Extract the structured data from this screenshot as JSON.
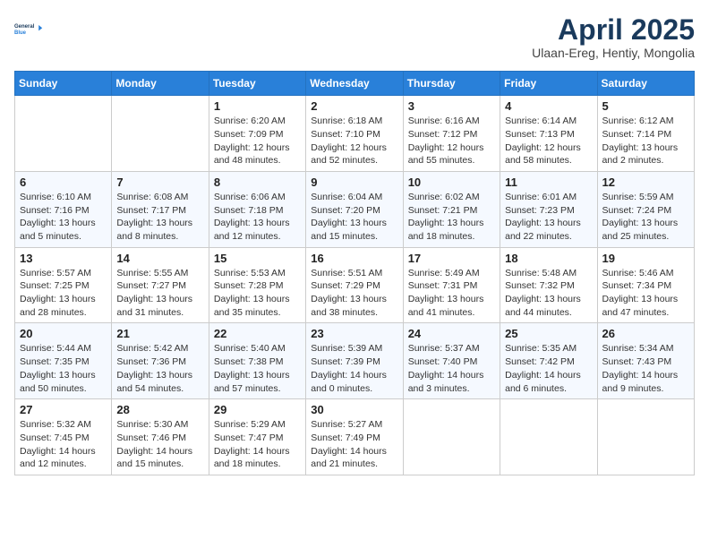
{
  "header": {
    "logo_line1": "General",
    "logo_line2": "Blue",
    "month_title": "April 2025",
    "subtitle": "Ulaan-Ereg, Hentiy, Mongolia"
  },
  "days_of_week": [
    "Sunday",
    "Monday",
    "Tuesday",
    "Wednesday",
    "Thursday",
    "Friday",
    "Saturday"
  ],
  "weeks": [
    [
      {
        "num": "",
        "info": ""
      },
      {
        "num": "",
        "info": ""
      },
      {
        "num": "1",
        "info": "Sunrise: 6:20 AM\nSunset: 7:09 PM\nDaylight: 12 hours and 48 minutes."
      },
      {
        "num": "2",
        "info": "Sunrise: 6:18 AM\nSunset: 7:10 PM\nDaylight: 12 hours and 52 minutes."
      },
      {
        "num": "3",
        "info": "Sunrise: 6:16 AM\nSunset: 7:12 PM\nDaylight: 12 hours and 55 minutes."
      },
      {
        "num": "4",
        "info": "Sunrise: 6:14 AM\nSunset: 7:13 PM\nDaylight: 12 hours and 58 minutes."
      },
      {
        "num": "5",
        "info": "Sunrise: 6:12 AM\nSunset: 7:14 PM\nDaylight: 13 hours and 2 minutes."
      }
    ],
    [
      {
        "num": "6",
        "info": "Sunrise: 6:10 AM\nSunset: 7:16 PM\nDaylight: 13 hours and 5 minutes."
      },
      {
        "num": "7",
        "info": "Sunrise: 6:08 AM\nSunset: 7:17 PM\nDaylight: 13 hours and 8 minutes."
      },
      {
        "num": "8",
        "info": "Sunrise: 6:06 AM\nSunset: 7:18 PM\nDaylight: 13 hours and 12 minutes."
      },
      {
        "num": "9",
        "info": "Sunrise: 6:04 AM\nSunset: 7:20 PM\nDaylight: 13 hours and 15 minutes."
      },
      {
        "num": "10",
        "info": "Sunrise: 6:02 AM\nSunset: 7:21 PM\nDaylight: 13 hours and 18 minutes."
      },
      {
        "num": "11",
        "info": "Sunrise: 6:01 AM\nSunset: 7:23 PM\nDaylight: 13 hours and 22 minutes."
      },
      {
        "num": "12",
        "info": "Sunrise: 5:59 AM\nSunset: 7:24 PM\nDaylight: 13 hours and 25 minutes."
      }
    ],
    [
      {
        "num": "13",
        "info": "Sunrise: 5:57 AM\nSunset: 7:25 PM\nDaylight: 13 hours and 28 minutes."
      },
      {
        "num": "14",
        "info": "Sunrise: 5:55 AM\nSunset: 7:27 PM\nDaylight: 13 hours and 31 minutes."
      },
      {
        "num": "15",
        "info": "Sunrise: 5:53 AM\nSunset: 7:28 PM\nDaylight: 13 hours and 35 minutes."
      },
      {
        "num": "16",
        "info": "Sunrise: 5:51 AM\nSunset: 7:29 PM\nDaylight: 13 hours and 38 minutes."
      },
      {
        "num": "17",
        "info": "Sunrise: 5:49 AM\nSunset: 7:31 PM\nDaylight: 13 hours and 41 minutes."
      },
      {
        "num": "18",
        "info": "Sunrise: 5:48 AM\nSunset: 7:32 PM\nDaylight: 13 hours and 44 minutes."
      },
      {
        "num": "19",
        "info": "Sunrise: 5:46 AM\nSunset: 7:34 PM\nDaylight: 13 hours and 47 minutes."
      }
    ],
    [
      {
        "num": "20",
        "info": "Sunrise: 5:44 AM\nSunset: 7:35 PM\nDaylight: 13 hours and 50 minutes."
      },
      {
        "num": "21",
        "info": "Sunrise: 5:42 AM\nSunset: 7:36 PM\nDaylight: 13 hours and 54 minutes."
      },
      {
        "num": "22",
        "info": "Sunrise: 5:40 AM\nSunset: 7:38 PM\nDaylight: 13 hours and 57 minutes."
      },
      {
        "num": "23",
        "info": "Sunrise: 5:39 AM\nSunset: 7:39 PM\nDaylight: 14 hours and 0 minutes."
      },
      {
        "num": "24",
        "info": "Sunrise: 5:37 AM\nSunset: 7:40 PM\nDaylight: 14 hours and 3 minutes."
      },
      {
        "num": "25",
        "info": "Sunrise: 5:35 AM\nSunset: 7:42 PM\nDaylight: 14 hours and 6 minutes."
      },
      {
        "num": "26",
        "info": "Sunrise: 5:34 AM\nSunset: 7:43 PM\nDaylight: 14 hours and 9 minutes."
      }
    ],
    [
      {
        "num": "27",
        "info": "Sunrise: 5:32 AM\nSunset: 7:45 PM\nDaylight: 14 hours and 12 minutes."
      },
      {
        "num": "28",
        "info": "Sunrise: 5:30 AM\nSunset: 7:46 PM\nDaylight: 14 hours and 15 minutes."
      },
      {
        "num": "29",
        "info": "Sunrise: 5:29 AM\nSunset: 7:47 PM\nDaylight: 14 hours and 18 minutes."
      },
      {
        "num": "30",
        "info": "Sunrise: 5:27 AM\nSunset: 7:49 PM\nDaylight: 14 hours and 21 minutes."
      },
      {
        "num": "",
        "info": ""
      },
      {
        "num": "",
        "info": ""
      },
      {
        "num": "",
        "info": ""
      }
    ]
  ]
}
